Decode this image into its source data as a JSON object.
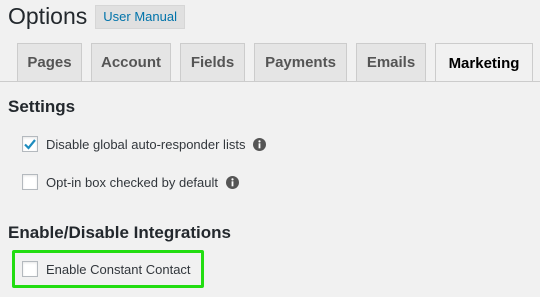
{
  "header": {
    "title": "Options",
    "manual_label": "User Manual"
  },
  "tabs": [
    {
      "label": "Pages"
    },
    {
      "label": "Account"
    },
    {
      "label": "Fields"
    },
    {
      "label": "Payments"
    },
    {
      "label": "Emails"
    },
    {
      "label": "Marketing",
      "active": true
    }
  ],
  "settings": {
    "title": "Settings",
    "options": [
      {
        "label": "Disable global auto-responder lists",
        "checked": true
      },
      {
        "label": "Opt-in box checked by default",
        "checked": false
      }
    ]
  },
  "integrations": {
    "title": "Enable/Disable Integrations",
    "options": [
      {
        "label": "Enable Constant Contact",
        "checked": false
      }
    ]
  },
  "colors": {
    "accent": "#0073aa",
    "highlight": "#22dd11"
  }
}
